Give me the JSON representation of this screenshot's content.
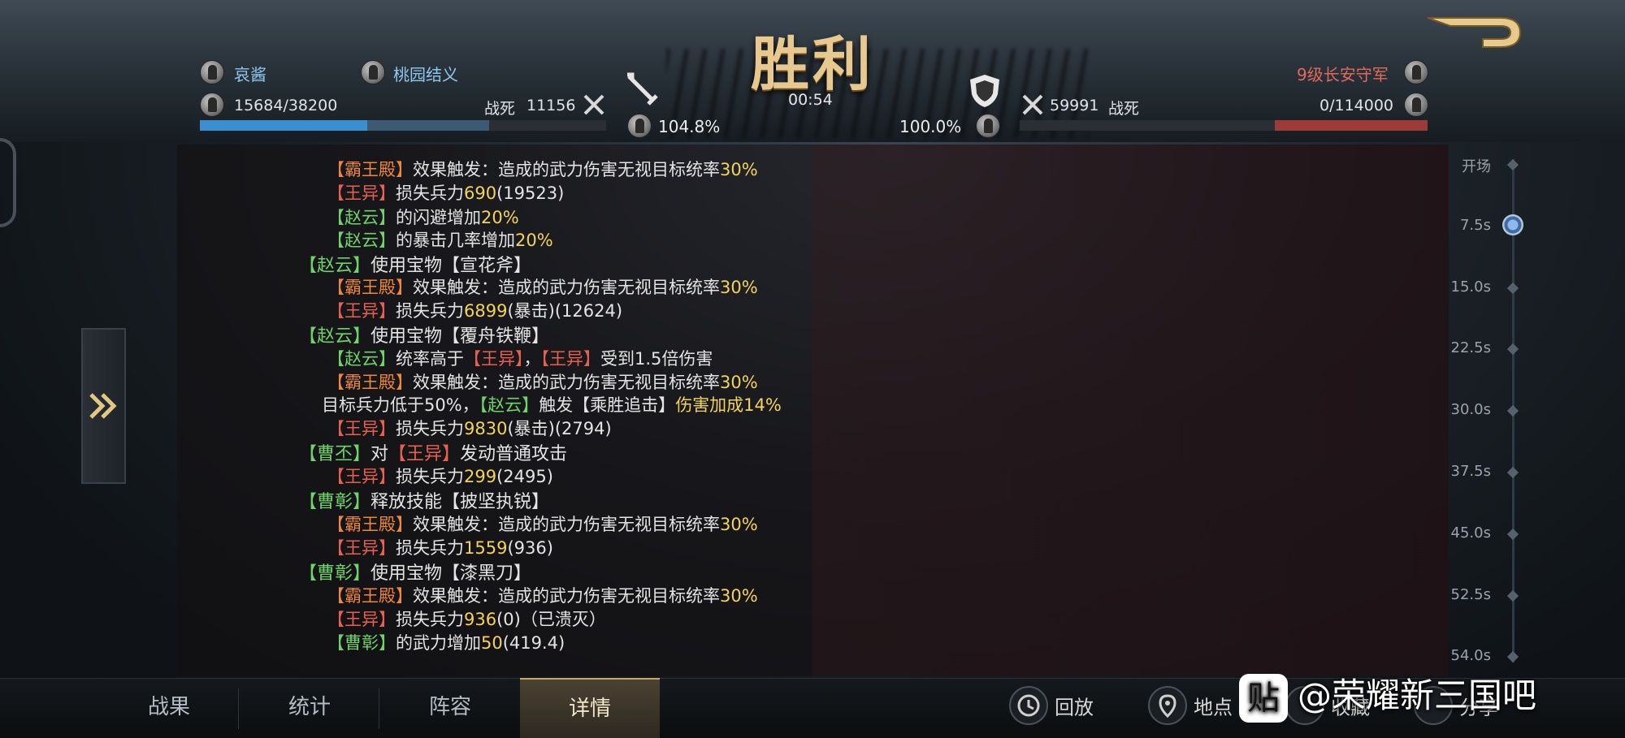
{
  "header": {
    "title": "胜利",
    "left_player": "哀酱",
    "left_alliance": "桃园结义",
    "left_troops": "15684/38200",
    "left_dead_label": "战死",
    "left_dead_value": "11156",
    "left_attack_pct": "104.8%",
    "timer": "00:54",
    "right_defense_pct": "100.0%",
    "right_dead_value": "59991",
    "right_dead_label": "战死",
    "right_troops": "0/114000",
    "right_player": "9级长安守军",
    "left_bar_fraction": 0.411,
    "right_bar_fraction": 0.0
  },
  "log": [
    {
      "parts": [
        {
          "t": "【霸王殿】",
          "c": "o"
        },
        {
          "t": "效果触发：造成的武力伤害无视目标统率"
        },
        {
          "t": "30%",
          "c": "y"
        }
      ]
    },
    {
      "parts": [
        {
          "t": "【王异】",
          "c": "r"
        },
        {
          "t": "损失兵力"
        },
        {
          "t": "690",
          "c": "y"
        },
        {
          "t": "(19523)"
        }
      ]
    },
    {
      "parts": [
        {
          "t": "【赵云】",
          "c": "g"
        },
        {
          "t": "的闪避增加"
        },
        {
          "t": "20%",
          "c": "y"
        }
      ]
    },
    {
      "parts": [
        {
          "t": "【赵云】",
          "c": "g"
        },
        {
          "t": "的暴击几率增加"
        },
        {
          "t": "20%",
          "c": "y"
        }
      ]
    },
    {
      "parts": [
        {
          "t": "【赵云】",
          "c": "g"
        },
        {
          "t": "使用宝物【宣花斧】"
        }
      ]
    },
    {
      "parts": [
        {
          "t": "【霸王殿】",
          "c": "o"
        },
        {
          "t": "效果触发：造成的武力伤害无视目标统率"
        },
        {
          "t": "30%",
          "c": "y"
        }
      ]
    },
    {
      "parts": [
        {
          "t": "【王异】",
          "c": "r"
        },
        {
          "t": "损失兵力"
        },
        {
          "t": "6899",
          "c": "y"
        },
        {
          "t": "(暴击)(12624)"
        }
      ]
    },
    {
      "parts": [
        {
          "t": "【赵云】",
          "c": "g"
        },
        {
          "t": "使用宝物【覆舟铁鞭】"
        }
      ]
    },
    {
      "parts": [
        {
          "t": "【赵云】",
          "c": "g"
        },
        {
          "t": "统率高于"
        },
        {
          "t": "【王异】",
          "c": "r"
        },
        {
          "t": "，"
        },
        {
          "t": "【王异】",
          "c": "r"
        },
        {
          "t": "受到1.5倍伤害"
        }
      ]
    },
    {
      "parts": [
        {
          "t": "【霸王殿】",
          "c": "o"
        },
        {
          "t": "效果触发：造成的武力伤害无视目标统率"
        },
        {
          "t": "30%",
          "c": "y"
        }
      ]
    },
    {
      "parts": [
        {
          "t": "目标兵力低于50%，"
        },
        {
          "t": "【赵云】",
          "c": "g"
        },
        {
          "t": "触发【乘胜追击】"
        },
        {
          "t": "伤害加成14%",
          "c": "y"
        }
      ]
    },
    {
      "parts": [
        {
          "t": "【王异】",
          "c": "r"
        },
        {
          "t": "损失兵力"
        },
        {
          "t": "9830",
          "c": "y"
        },
        {
          "t": "(暴击)(2794)"
        }
      ]
    },
    {
      "parts": [
        {
          "t": "【曹丕】",
          "c": "g"
        },
        {
          "t": "对"
        },
        {
          "t": "【王异】",
          "c": "r"
        },
        {
          "t": "发动普通攻击"
        }
      ]
    },
    {
      "parts": [
        {
          "t": "【王异】",
          "c": "r"
        },
        {
          "t": "损失兵力"
        },
        {
          "t": "299",
          "c": "y"
        },
        {
          "t": "(2495)"
        }
      ]
    },
    {
      "parts": [
        {
          "t": "【曹彰】",
          "c": "g"
        },
        {
          "t": "释放技能【披坚执锐】"
        }
      ]
    },
    {
      "parts": [
        {
          "t": "【霸王殿】",
          "c": "o"
        },
        {
          "t": "效果触发：造成的武力伤害无视目标统率"
        },
        {
          "t": "30%",
          "c": "y"
        }
      ]
    },
    {
      "parts": [
        {
          "t": "【王异】",
          "c": "r"
        },
        {
          "t": "损失兵力"
        },
        {
          "t": "1559",
          "c": "y"
        },
        {
          "t": "(936)"
        }
      ]
    },
    {
      "parts": [
        {
          "t": "【曹彰】",
          "c": "g"
        },
        {
          "t": "使用宝物【漆黑刀】"
        }
      ]
    },
    {
      "parts": [
        {
          "t": "【霸王殿】",
          "c": "o"
        },
        {
          "t": "效果触发：造成的武力伤害无视目标统率"
        },
        {
          "t": "30%",
          "c": "y"
        }
      ]
    },
    {
      "parts": [
        {
          "t": "【王异】",
          "c": "r"
        },
        {
          "t": "损失兵力"
        },
        {
          "t": "936",
          "c": "y"
        },
        {
          "t": "(0)（已溃灭）"
        }
      ]
    },
    {
      "parts": [
        {
          "t": "【曹彰】",
          "c": "g"
        },
        {
          "t": "的武力增加"
        },
        {
          "t": "50",
          "c": "y"
        },
        {
          "t": "(419.4)"
        }
      ]
    }
  ],
  "timeline": [
    "开场",
    "7.5s",
    "15.0s",
    "22.5s",
    "30.0s",
    "37.5s",
    "45.0s",
    "52.5s",
    "54.0s"
  ],
  "timeline_active_index": 1,
  "tabs": [
    "战果",
    "统计",
    "阵容",
    "详情"
  ],
  "active_tab_index": 3,
  "actions": {
    "replay": "回放",
    "location": "地点",
    "favorite": "收藏",
    "share": "分享"
  },
  "watermark": {
    "logo": "贴",
    "text": "@荣耀新三国吧"
  },
  "colors": {
    "ally_green": "#6fd36a",
    "enemy_red": "#e8604f",
    "building_orange": "#f0883a",
    "value_yellow": "#f3d35c",
    "left_bar": "#3a8fd0",
    "right_bar": "#9c3b38"
  }
}
